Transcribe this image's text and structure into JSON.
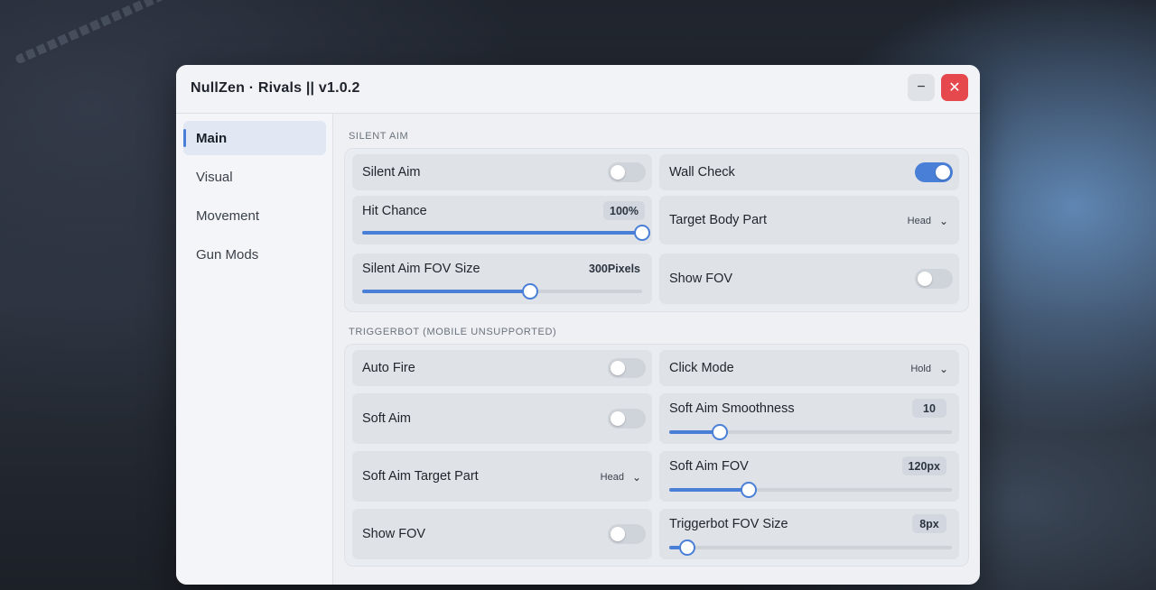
{
  "window": {
    "title": "NullZen · Rivals || v1.0.2",
    "minimize_glyph": "−",
    "close_glyph": "✕"
  },
  "colors": {
    "accent": "#4a7fd8",
    "close": "#e5484d"
  },
  "sidebar": {
    "items": [
      {
        "label": "Main",
        "active": true
      },
      {
        "label": "Visual",
        "active": false
      },
      {
        "label": "Movement",
        "active": false
      },
      {
        "label": "Gun Mods",
        "active": false
      }
    ]
  },
  "silent_aim": {
    "section_label": "SILENT AIM",
    "silent_aim": {
      "label": "Silent Aim",
      "enabled": false
    },
    "wall_check": {
      "label": "Wall Check",
      "enabled": true
    },
    "hit_chance": {
      "label": "Hit Chance",
      "value": "100%",
      "fraction": 1.0
    },
    "target_body_part": {
      "label": "Target Body Part",
      "value": "Head"
    },
    "fov_size": {
      "label": "Silent Aim FOV Size",
      "value": "300Pixels",
      "fraction": 0.6
    },
    "show_fov": {
      "label": "Show FOV",
      "enabled": false
    }
  },
  "triggerbot": {
    "section_label": "TRIGGERBOT (MOBILE UNSUPPORTED)",
    "auto_fire": {
      "label": "Auto Fire",
      "enabled": false
    },
    "click_mode": {
      "label": "Click Mode",
      "value": "Hold"
    },
    "soft_aim": {
      "label": "Soft Aim",
      "enabled": false
    },
    "soft_aim_smoothness": {
      "label": "Soft Aim Smoothness",
      "value": "10",
      "fraction": 0.18
    },
    "soft_aim_target_part": {
      "label": "Soft Aim Target Part",
      "value": "Head"
    },
    "soft_aim_fov": {
      "label": "Soft Aim FOV",
      "value": "120px",
      "fraction": 0.28
    },
    "show_fov": {
      "label": "Show FOV",
      "enabled": false
    },
    "triggerbot_fov_size": {
      "label": "Triggerbot FOV Size",
      "value": "8px",
      "fraction": 0.065
    }
  }
}
